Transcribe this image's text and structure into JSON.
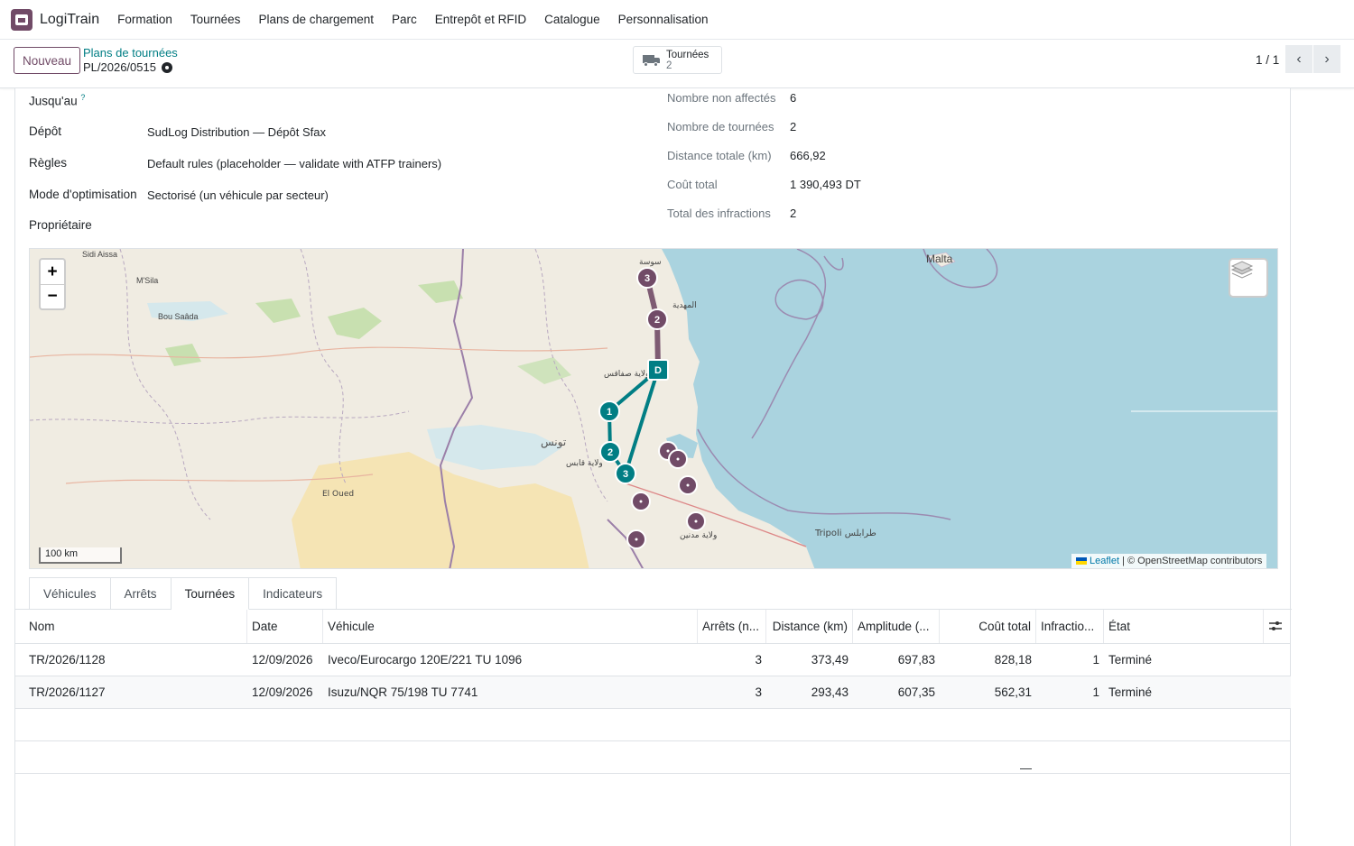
{
  "app": {
    "name": "LogiTrain",
    "menu": [
      "Formation",
      "Tournées",
      "Plans de chargement",
      "Parc",
      "Entrepôt et RFID",
      "Catalogue",
      "Personnalisation"
    ]
  },
  "control": {
    "new_label": "Nouveau",
    "breadcrumb_parent": "Plans de tournées",
    "breadcrumb_current": "PL/2026/0515",
    "smart_button": {
      "label": "Tournées",
      "count": "2"
    },
    "pager": "1 / 1"
  },
  "form": {
    "left": [
      {
        "label": "Jusqu'au",
        "help": "?",
        "value": ""
      },
      {
        "label": "Dépôt",
        "value": "SudLog Distribution — Dépôt Sfax"
      },
      {
        "label": "Règles",
        "value": "Default rules (placeholder — validate with ATFP trainers)"
      },
      {
        "label": "Mode d'optimisation",
        "value": "Sectorisé (un véhicule par secteur)"
      },
      {
        "label": "Propriétaire",
        "value": ""
      }
    ],
    "right": [
      {
        "label": "Nombre non affectés",
        "value": "6"
      },
      {
        "label": "Nombre de tournées",
        "value": "2"
      },
      {
        "label": "Distance totale (km)",
        "value": "666,92"
      },
      {
        "label": "Coût total",
        "value": "1 390,493 DT"
      },
      {
        "label": "Total des infractions",
        "value": "2"
      }
    ]
  },
  "map": {
    "zoom_in": "+",
    "zoom_out": "−",
    "scale": "100 km",
    "attribution_link": "Leaflet",
    "attribution_text": "| © OpenStreetMap contributors",
    "depot_label": "D",
    "route_colors": {
      "route_1": "#017e84",
      "route_2": "#714b67",
      "unassigned": "#714b67"
    },
    "place_labels": [
      "Malta",
      "Sidi Aissa",
      "M'Sila",
      "Bou Saâda",
      "تونس",
      "El Oued",
      "Tripoli طرابلس",
      "سوسة",
      "المهدية",
      "ولاية صفاقس",
      "ولاية قابس",
      "ولاية مدنين"
    ],
    "route_1_stops": [
      "1",
      "2",
      "3"
    ],
    "route_2_stops": [
      "2",
      "3"
    ],
    "unassigned_count": "6"
  },
  "tabs": [
    {
      "label": "Véhicules",
      "active": false
    },
    {
      "label": "Arrêts",
      "active": false
    },
    {
      "label": "Tournées",
      "active": true
    },
    {
      "label": "Indicateurs",
      "active": false
    }
  ],
  "table": {
    "headers": [
      "Nom",
      "Date",
      "Véhicule",
      "Arrêts (n...",
      "Distance (km)",
      "Amplitude (...",
      "Coût total",
      "Infractio...",
      "État"
    ],
    "rows": [
      [
        "TR/2026/1128",
        "12/09/2026",
        "Iveco/Eurocargo 120E/221 TU 1096",
        "3",
        "373,49",
        "697,83",
        "828,18",
        "1",
        "Terminé"
      ],
      [
        "TR/2026/1127",
        "12/09/2026",
        "Isuzu/NQR 75/198 TU 7741",
        "3",
        "293,43",
        "607,35",
        "562,31",
        "1",
        "Terminé"
      ]
    ],
    "footer_dash": "—"
  }
}
